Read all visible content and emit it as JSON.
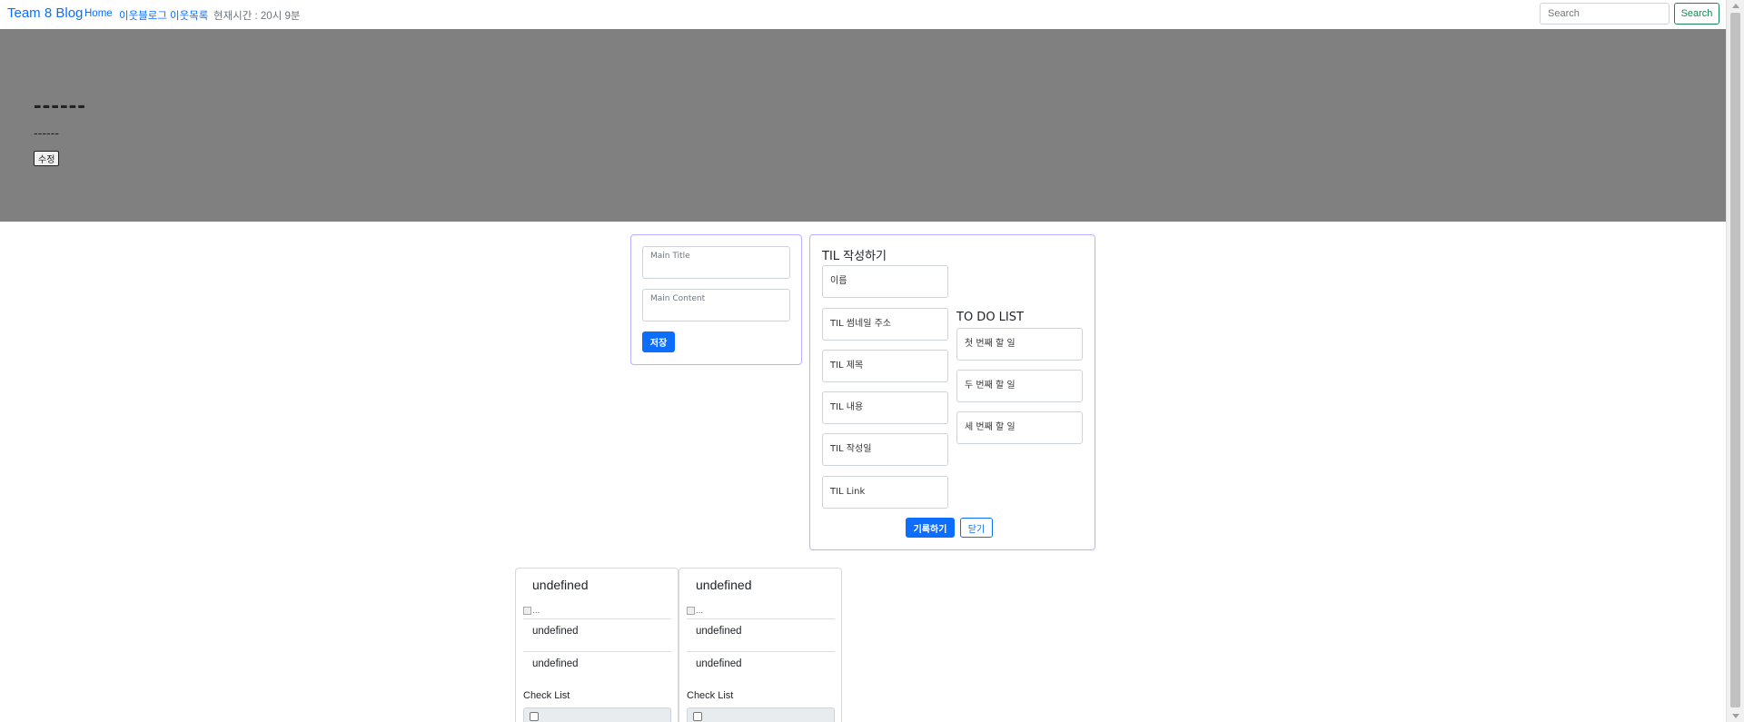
{
  "navbar": {
    "brand": "Team 8 Blog",
    "links": [
      "Home",
      "이웃블로그",
      "이웃목록"
    ],
    "time_text": "현재시간 : 20시 9분",
    "search_placeholder": "Search",
    "search_button": "Search"
  },
  "hero": {
    "title": "------",
    "subtitle": "------",
    "edit_button": "수정"
  },
  "main_form": {
    "title_placeholder": "Main Title",
    "content_placeholder": "Main Content",
    "save_button": "저장"
  },
  "til_form": {
    "heading": "TIL 작성하기",
    "fields": [
      "이름",
      "TIL 썸네일 주소",
      "TIL 제목",
      "TIL 내용",
      "TIL 작성일",
      "TIL Link"
    ],
    "todo_heading": "TO DO LIST",
    "todo_fields": [
      "첫 번째 할 일",
      "두 번째 할 일",
      "세 번째 할 일"
    ],
    "submit_button": "기록하기",
    "close_button": "닫기"
  },
  "cards": [
    {
      "title": "undefined",
      "img_alt": "...",
      "text1": "undefined",
      "text2": "undefined",
      "check_label": "Check List"
    },
    {
      "title": "undefined",
      "img_alt": "...",
      "text1": "undefined",
      "text2": "undefined",
      "check_label": "Check List"
    }
  ],
  "colors": {
    "primary": "#0d6efd",
    "success": "#198754",
    "hero_bg": "#808080",
    "panel_border": "#b3b3ff"
  }
}
